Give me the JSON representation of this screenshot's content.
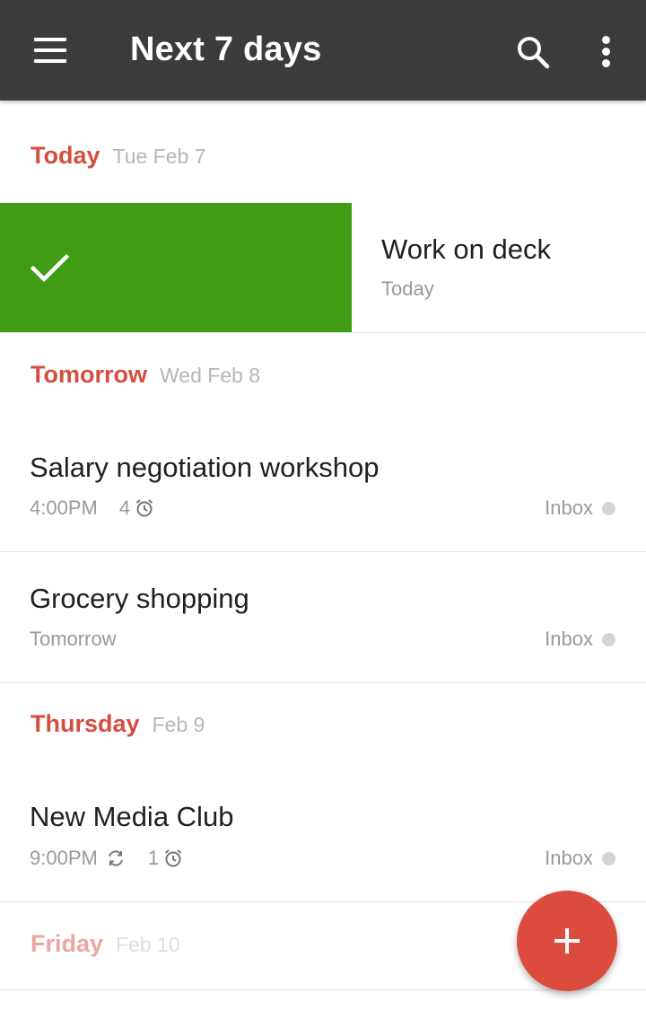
{
  "appbar": {
    "title": "Next 7 days",
    "menu_icon": "hamburger-menu-icon",
    "search_icon": "search-icon",
    "overflow_icon": "more-vertical-icon",
    "background": "#3c3c3c"
  },
  "colors": {
    "accent": "#d44e3f",
    "complete_swipe": "#3f9c14",
    "fab": "#db4c3f"
  },
  "sections": [
    {
      "day": "Today",
      "date": "Tue Feb 7",
      "tasks": [
        {
          "name": "Work on deck",
          "due": "Today",
          "swiped_complete": true
        }
      ]
    },
    {
      "day": "Tomorrow",
      "date": "Wed Feb 8",
      "tasks": [
        {
          "name": "Salary negotiation workshop",
          "time": "4:00PM",
          "reminders": "4",
          "project": "Inbox"
        },
        {
          "name": "Grocery shopping",
          "due": "Tomorrow",
          "project": "Inbox"
        }
      ]
    },
    {
      "day": "Thursday",
      "date": "Feb 9",
      "tasks": [
        {
          "name": "New Media Club",
          "time": "9:00PM",
          "recurring": true,
          "reminders": "1",
          "project": "Inbox"
        }
      ]
    },
    {
      "day": "Friday",
      "date": "Feb 10",
      "tasks": []
    }
  ],
  "fab": {
    "icon": "plus-icon"
  }
}
